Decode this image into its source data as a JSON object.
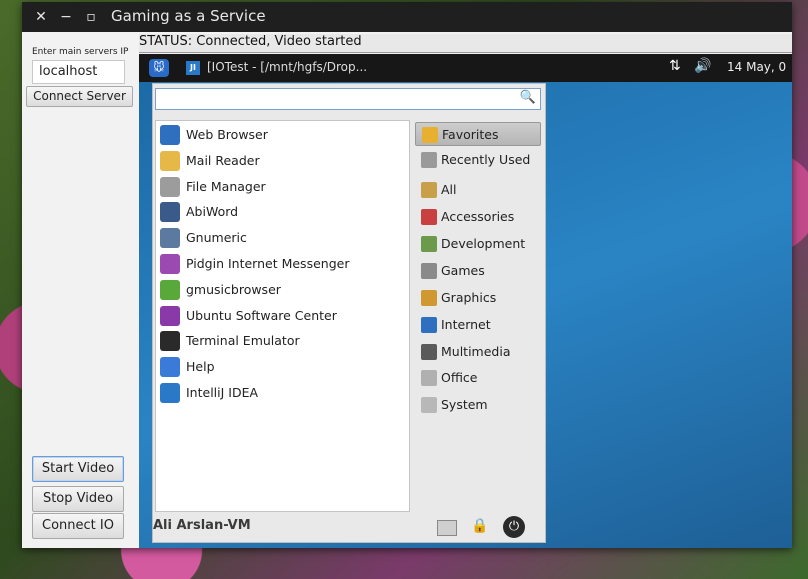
{
  "window": {
    "title": "Gaming as a Service"
  },
  "left": {
    "ip_label": "Enter main servers IP",
    "ip_value": "localhost",
    "connect_label": "Connect Server",
    "start_video": "Start Video",
    "stop_video": "Stop Video",
    "connect_io": "Connect IO"
  },
  "status": "STATUS:  Connected, Video started",
  "remote": {
    "taskbar_title": "[IOTest - [/mnt/hgfs/Drop...",
    "clock": "14 May, 0",
    "menu": {
      "apps": [
        {
          "label": "Web Browser",
          "color": "#2f6fc0"
        },
        {
          "label": "Mail Reader",
          "color": "#e6b848"
        },
        {
          "label": "File Manager",
          "color": "#9c9c9c"
        },
        {
          "label": "AbiWord",
          "color": "#3a5a8a"
        },
        {
          "label": "Gnumeric",
          "color": "#5c7aa0"
        },
        {
          "label": "Pidgin Internet Messenger",
          "color": "#9a4ab0"
        },
        {
          "label": "gmusicbrowser",
          "color": "#58a83a"
        },
        {
          "label": "Ubuntu Software Center",
          "color": "#8a3aa8"
        },
        {
          "label": "Terminal Emulator",
          "color": "#2a2a2a"
        },
        {
          "label": "Help",
          "color": "#3a7ad8"
        },
        {
          "label": "IntelliJ IDEA",
          "color": "#2a78c8"
        }
      ],
      "categories": [
        {
          "label": "Favorites",
          "color": "#e8b030"
        },
        {
          "label": "Recently Used",
          "color": "#9a9a9a"
        },
        {
          "label": "All",
          "color": "#c8a04a"
        },
        {
          "label": "Accessories",
          "color": "#c84040"
        },
        {
          "label": "Development",
          "color": "#6a9a4a"
        },
        {
          "label": "Games",
          "color": "#8a8a8a"
        },
        {
          "label": "Graphics",
          "color": "#d09830"
        },
        {
          "label": "Internet",
          "color": "#2f6fc0"
        },
        {
          "label": "Multimedia",
          "color": "#5a5a5a"
        },
        {
          "label": "Office",
          "color": "#b0b0b0"
        },
        {
          "label": "System",
          "color": "#b8b8b8"
        }
      ],
      "user": "Ali Arslan-VM"
    }
  }
}
